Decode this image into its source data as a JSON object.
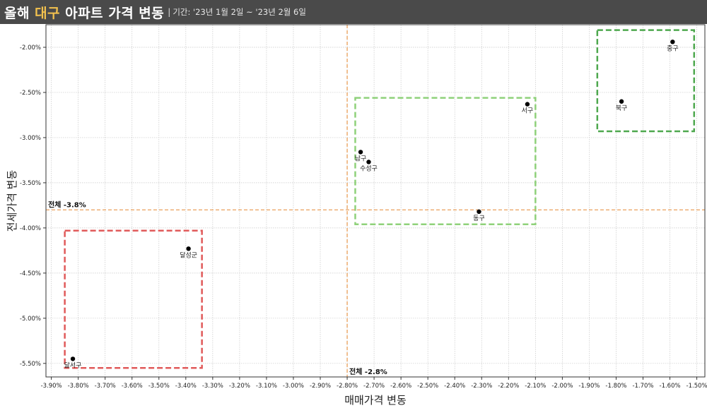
{
  "header": {
    "title_prefix": "올해 ",
    "title_highlight": "대구",
    "title_suffix": " 아파트 가격 변동",
    "separator": "|",
    "period": "기간: '23년 1월 2일 ~ '23년 2월 6일"
  },
  "colors": {
    "highlight": "#f2c14e",
    "reference_line": "#e8964a",
    "box_red": "#e05a5a",
    "box_light_green": "#8fd17a",
    "box_green": "#4ea84e",
    "point": "#000000"
  },
  "chart_data": {
    "type": "scatter",
    "xlabel": "매매가격 변동",
    "ylabel": "전세가격 변동",
    "xlim": [
      -3.92,
      -1.47
    ],
    "ylim": [
      -5.65,
      -1.75
    ],
    "x_ticks": [
      -3.9,
      -3.8,
      -3.7,
      -3.6,
      -3.5,
      -3.4,
      -3.3,
      -3.2,
      -3.1,
      -3.0,
      -2.9,
      -2.8,
      -2.7,
      -2.6,
      -2.5,
      -2.4,
      -2.3,
      -2.2,
      -2.1,
      -2.0,
      -1.9,
      -1.8,
      -1.7,
      -1.6,
      -1.5
    ],
    "x_tick_labels": [
      "-3.90%",
      "-3.80%",
      "-3.70%",
      "-3.60%",
      "-3.50%",
      "-3.40%",
      "-3.30%",
      "-3.20%",
      "-3.10%",
      "-3.00%",
      "-2.90%",
      "-2.80%",
      "-2.70%",
      "-2.60%",
      "-2.50%",
      "-2.40%",
      "-2.30%",
      "-2.20%",
      "-2.10%",
      "-2.00%",
      "-1.90%",
      "-1.80%",
      "-1.70%",
      "-1.60%",
      "-1.50%"
    ],
    "y_ticks": [
      -2.0,
      -2.5,
      -3.0,
      -3.5,
      -4.0,
      -4.5,
      -5.0,
      -5.5
    ],
    "y_tick_labels": [
      "-2.00%",
      "-2.50%",
      "-3.00%",
      "-3.50%",
      "-4.00%",
      "-4.50%",
      "-5.00%",
      "-5.50%"
    ],
    "grid": true,
    "points": [
      {
        "label": "중구",
        "x": -1.59,
        "y": -1.94
      },
      {
        "label": "북구",
        "x": -1.78,
        "y": -2.6
      },
      {
        "label": "서구",
        "x": -2.13,
        "y": -2.63
      },
      {
        "label": "남구",
        "x": -2.75,
        "y": -3.16
      },
      {
        "label": "수성구",
        "x": -2.72,
        "y": -3.27
      },
      {
        "label": "동구",
        "x": -2.31,
        "y": -3.82
      },
      {
        "label": "달성군",
        "x": -3.39,
        "y": -4.23
      },
      {
        "label": "달서구",
        "x": -3.82,
        "y": -5.45
      }
    ],
    "reference_lines": {
      "x": {
        "value": -2.8,
        "label": "전체 -2.8%"
      },
      "y": {
        "value": -3.8,
        "label": "전체 -3.8%"
      }
    },
    "groups": [
      {
        "color_key": "box_red",
        "x_range": [
          -3.85,
          -3.34
        ],
        "y_range": [
          -5.55,
          -4.03
        ]
      },
      {
        "color_key": "box_light_green",
        "x_range": [
          -2.77,
          -2.1
        ],
        "y_range": [
          -3.96,
          -2.56
        ]
      },
      {
        "color_key": "box_green",
        "x_range": [
          -1.87,
          -1.51
        ],
        "y_range": [
          -2.93,
          -1.81
        ]
      }
    ]
  }
}
